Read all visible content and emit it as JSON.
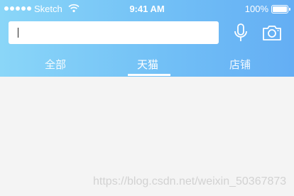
{
  "status_bar": {
    "carrier": "Sketch",
    "time": "9:41 AM",
    "battery": "100%"
  },
  "search": {
    "value": "",
    "placeholder": ""
  },
  "tabs": [
    {
      "label": "全部"
    },
    {
      "label": "天猫"
    },
    {
      "label": "店铺"
    }
  ],
  "active_tab": "天猫",
  "watermark": "https://blog.csdn.net/weixin_50367873",
  "colors": {
    "gradient_start": "#8ad6f8",
    "gradient_end": "#64aef4",
    "page_background": "#f4f4f4"
  },
  "icons": [
    "signal-dots-icon",
    "wifi-icon",
    "battery-icon",
    "microphone-icon",
    "camera-icon"
  ]
}
